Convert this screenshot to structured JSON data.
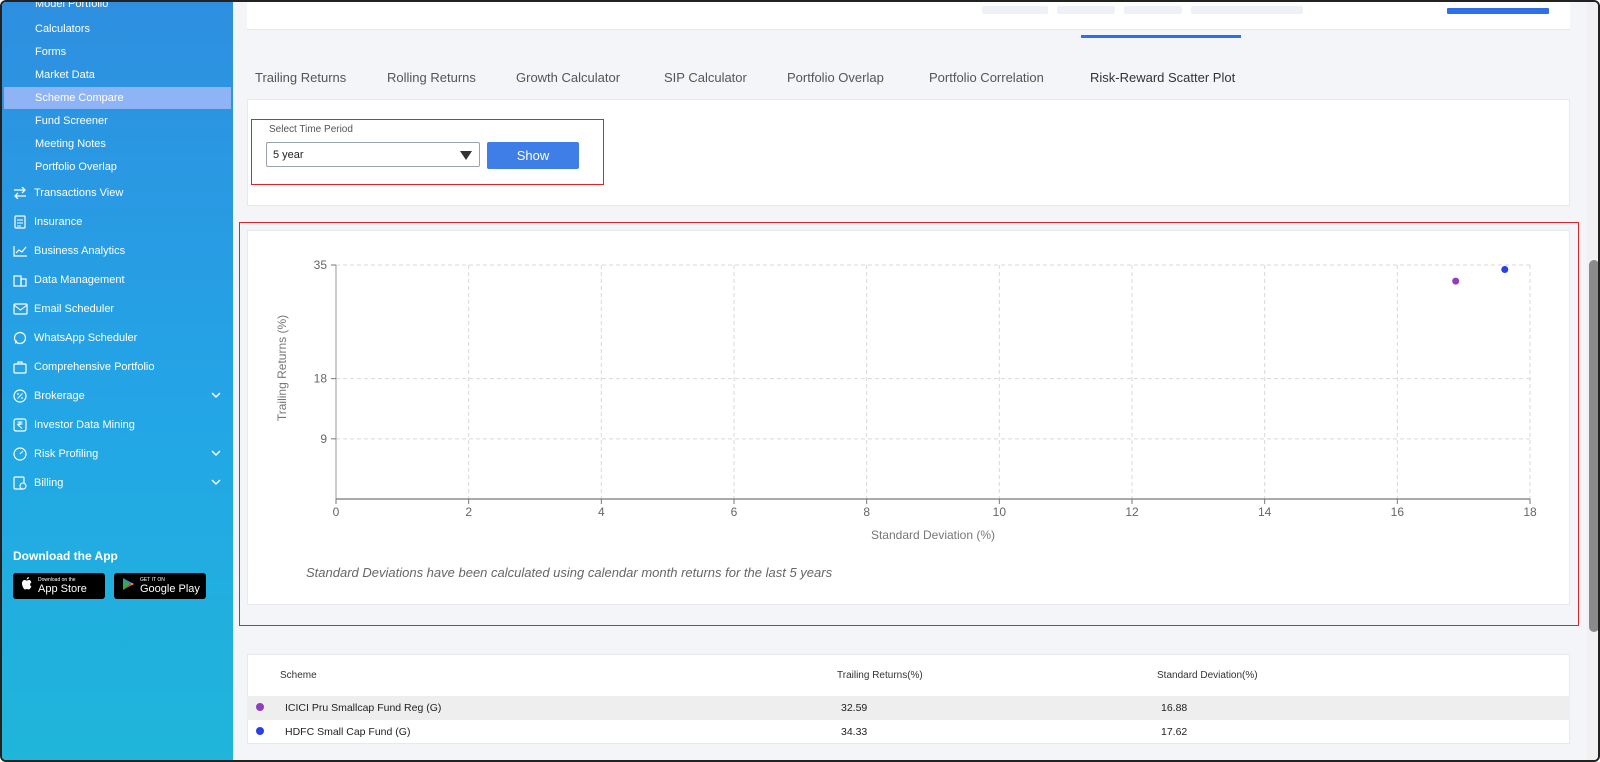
{
  "sidebar": {
    "sub_items": [
      "Model Portfolio",
      "Calculators",
      "Forms",
      "Market Data",
      "Scheme Compare",
      "Fund Screener",
      "Meeting Notes",
      "Portfolio Overlap"
    ],
    "active_sub_item": "Scheme Compare",
    "nav_items": [
      {
        "label": "Transactions View",
        "icon": "arrows-swap-icon",
        "has_chevron": false
      },
      {
        "label": "Insurance",
        "icon": "document-icon",
        "has_chevron": false
      },
      {
        "label": "Business Analytics",
        "icon": "line-chart-icon",
        "has_chevron": false
      },
      {
        "label": "Data Management",
        "icon": "building-icon",
        "has_chevron": false
      },
      {
        "label": "Email Scheduler",
        "icon": "mail-icon",
        "has_chevron": false
      },
      {
        "label": "WhatsApp Scheduler",
        "icon": "whatsapp-icon",
        "has_chevron": false
      },
      {
        "label": "Comprehensive Portfolio",
        "icon": "briefcase-icon",
        "has_chevron": false
      },
      {
        "label": "Brokerage",
        "icon": "percent-icon",
        "has_chevron": true
      },
      {
        "label": "Investor Data Mining",
        "icon": "rupee-icon",
        "has_chevron": false
      },
      {
        "label": "Risk Profiling",
        "icon": "gauge-icon",
        "has_chevron": true
      },
      {
        "label": "Billing",
        "icon": "bill-icon",
        "has_chevron": true
      }
    ],
    "download_title": "Download the App",
    "app_store": {
      "small": "Download on the",
      "big": "App Store"
    },
    "google_play": {
      "small": "GET IT ON",
      "big": "Google Play"
    }
  },
  "tabs": [
    "Trailing Returns",
    "Rolling Returns",
    "Growth Calculator",
    "SIP Calculator",
    "Portfolio Overlap",
    "Portfolio Correlation",
    "Risk-Reward Scatter Plot"
  ],
  "active_tab": "Risk-Reward Scatter Plot",
  "filter": {
    "label": "Select Time Period",
    "selected": "5 year",
    "show_label": "Show"
  },
  "chart_data": {
    "type": "scatter",
    "xlabel": "Standard Deviation (%)",
    "ylabel": "Trailing Returns (%)",
    "xlim": [
      0,
      18
    ],
    "ylim": [
      0,
      35
    ],
    "xticks": [
      0,
      2,
      4,
      6,
      8,
      10,
      12,
      14,
      16,
      18
    ],
    "yticks": [
      9,
      18,
      35
    ],
    "grid": true,
    "series": [
      {
        "name": "ICICI Pru Smallcap Fund Reg (G)",
        "color": "#8e3fc0",
        "points": [
          {
            "x": 16.88,
            "y": 32.59
          }
        ]
      },
      {
        "name": "HDFC Small Cap Fund (G)",
        "color": "#2b3fe6",
        "points": [
          {
            "x": 17.62,
            "y": 34.33
          }
        ]
      }
    ]
  },
  "chart_note": "Standard Deviations have been calculated using calendar month returns for the last 5 years",
  "table": {
    "headers": [
      "Scheme",
      "Trailing Returns(%)",
      "Standard Deviation(%)"
    ],
    "rows": [
      {
        "scheme": "ICICI Pru Smallcap Fund Reg (G)",
        "returns": "32.59",
        "sd": "16.88",
        "color": "#8e3fc0"
      },
      {
        "scheme": "HDFC Small Cap Fund (G)",
        "returns": "34.33",
        "sd": "17.62",
        "color": "#2b3fe6"
      }
    ]
  }
}
